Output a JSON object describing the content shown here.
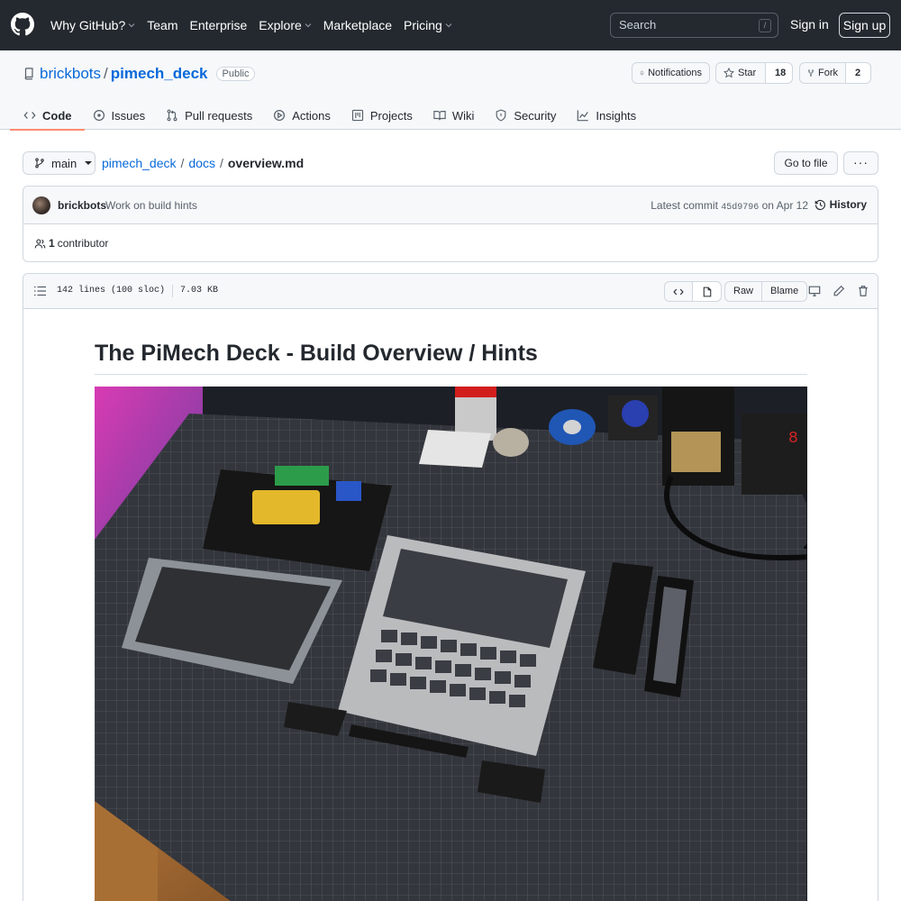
{
  "header": {
    "nav": [
      {
        "label": "Why GitHub?",
        "dropdown": true
      },
      {
        "label": "Team",
        "dropdown": false
      },
      {
        "label": "Enterprise",
        "dropdown": false
      },
      {
        "label": "Explore",
        "dropdown": true
      },
      {
        "label": "Marketplace",
        "dropdown": false
      },
      {
        "label": "Pricing",
        "dropdown": true
      }
    ],
    "search_placeholder": "Search",
    "search_shortcut": "/",
    "sign_in": "Sign in",
    "sign_up": "Sign up"
  },
  "repo": {
    "owner": "brickbots",
    "separator": "/",
    "name": "pimech_deck",
    "visibility": "Public",
    "notifications_label": "Notifications",
    "star_label": "Star",
    "star_count": "18",
    "fork_label": "Fork",
    "fork_count": "2",
    "tabs": [
      {
        "label": "Code",
        "icon": "code-icon",
        "active": true
      },
      {
        "label": "Issues",
        "icon": "issue-icon",
        "active": false
      },
      {
        "label": "Pull requests",
        "icon": "pull-request-icon",
        "active": false
      },
      {
        "label": "Actions",
        "icon": "play-icon",
        "active": false
      },
      {
        "label": "Projects",
        "icon": "project-icon",
        "active": false
      },
      {
        "label": "Wiki",
        "icon": "book-icon",
        "active": false
      },
      {
        "label": "Security",
        "icon": "shield-icon",
        "active": false
      },
      {
        "label": "Insights",
        "icon": "graph-icon",
        "active": false
      }
    ]
  },
  "file_nav": {
    "branch": "main",
    "path": [
      {
        "label": "pimech_deck",
        "link": true
      },
      {
        "label": "docs",
        "link": true
      },
      {
        "label": "overview.md",
        "link": false
      }
    ],
    "path_separator": "/",
    "go_to_file": "Go to file",
    "more": "···"
  },
  "commit": {
    "author": "brickbots",
    "message": "Work on build hints",
    "latest_prefix": "Latest commit",
    "sha": "45d9796",
    "date": "on Apr 12",
    "history_label": "History",
    "contributors_count": "1",
    "contributors_label": "contributor"
  },
  "file": {
    "lines": "142 lines (100 sloc)",
    "size": "7.03 KB",
    "raw_label": "Raw",
    "blame_label": "Blame"
  },
  "markdown": {
    "title": "The PiMech Deck - Build Overview / Hints"
  },
  "colors": {
    "header_bg": "#24292f",
    "link": "#0969da",
    "active_tab_underline": "#fd8c73",
    "border": "#d0d7de"
  }
}
